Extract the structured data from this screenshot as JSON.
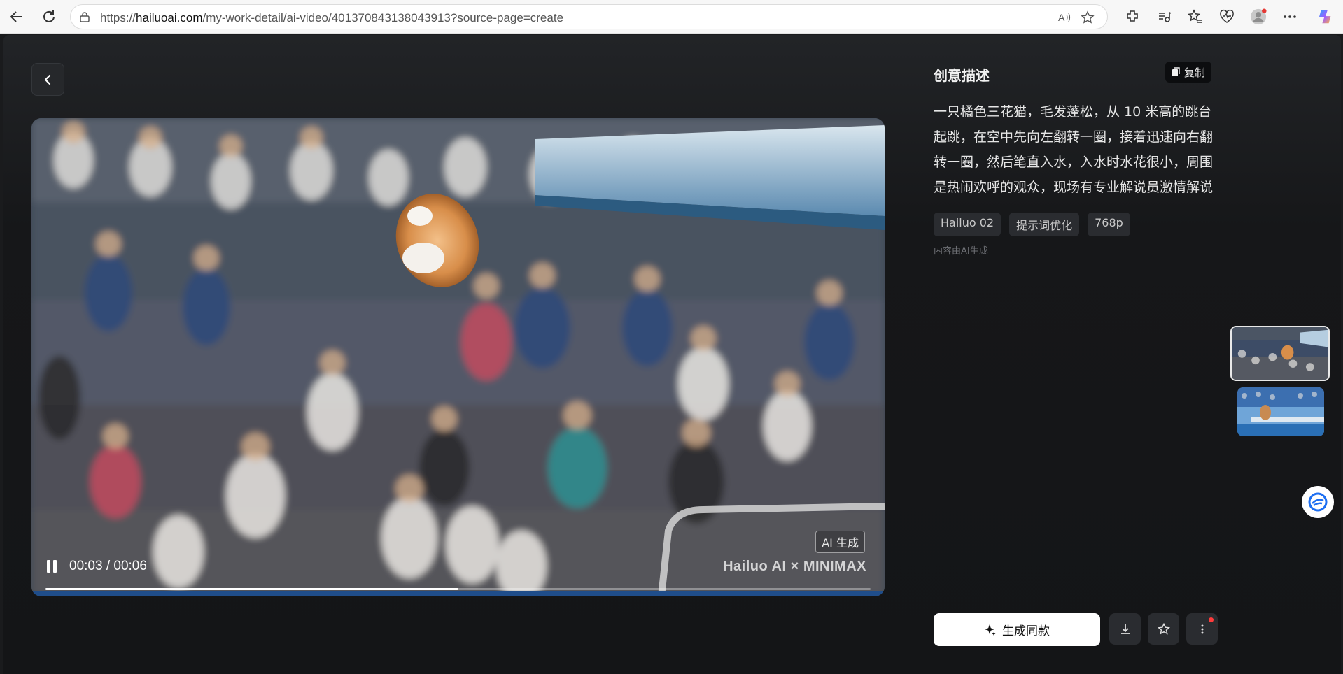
{
  "browser": {
    "url_prefix": "https://",
    "url_domain": "hailuoai.com",
    "url_path": "/my-work-detail/ai-video/401370843138043913?source-page=create",
    "icons": [
      "back-icon",
      "refresh-icon",
      "lock-icon",
      "read-aloud-icon",
      "favorite-star-icon",
      "extensions-icon",
      "media-icon",
      "favorites-icon",
      "health-icon",
      "profile-avatar",
      "more-icon",
      "copilot-icon"
    ]
  },
  "player": {
    "ai_tag": "AI 生成",
    "watermark": "Hailuo AI × MINIMAX",
    "current_time": "00:03",
    "separator": "/",
    "duration": "00:06",
    "progress_fraction": 0.5
  },
  "panel": {
    "title": "创意描述",
    "copy_label": "复制",
    "description": "一只橘色三花猫，毛发蓬松，从 10 米高的跳台起跳，在空中先向左翻转一圈，接着迅速向右翻转一圈，然后笔直入水，入水时水花很小，周围是热闹欢呼的观众，现场有专业解说员激情解说",
    "tags": [
      "Hailuo 02",
      "提示词优化",
      "768p"
    ],
    "ai_note": "内容由AI生成"
  },
  "actions": {
    "generate_label": "生成同款"
  },
  "colors": {
    "background": "#141517",
    "panel_text": "#e6e6e6",
    "tag_bg": "#2a2c30",
    "notification": "#ff3b3b"
  }
}
